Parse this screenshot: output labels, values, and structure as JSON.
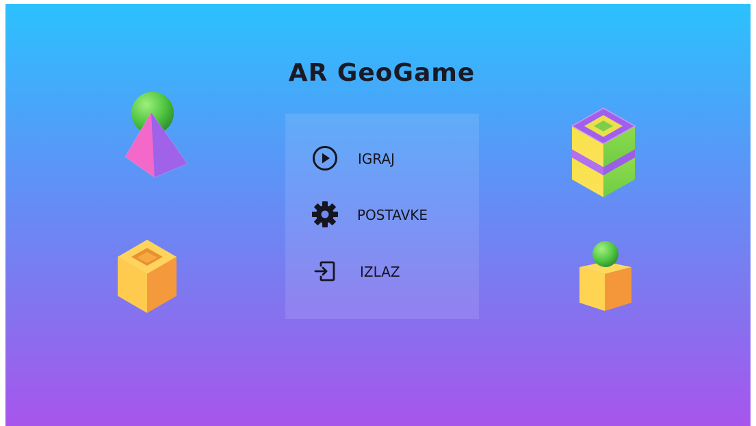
{
  "app": {
    "title": "AR GeoGame"
  },
  "menu": {
    "items": [
      {
        "label": "IGRAJ",
        "icon": "play-circle-icon"
      },
      {
        "label": "POSTAVKE",
        "icon": "gear-icon"
      },
      {
        "label": "IZLAZ",
        "icon": "exit-icon"
      }
    ]
  },
  "decorations": [
    "sphere-on-pyramid",
    "hollow-cube-orange",
    "stacked-hollow-cubes-purple-green",
    "sphere-on-cube-orange"
  ],
  "colors": {
    "gradient_top": "#2bc1fe",
    "gradient_bottom": "#a855ec",
    "text": "#15151f"
  }
}
